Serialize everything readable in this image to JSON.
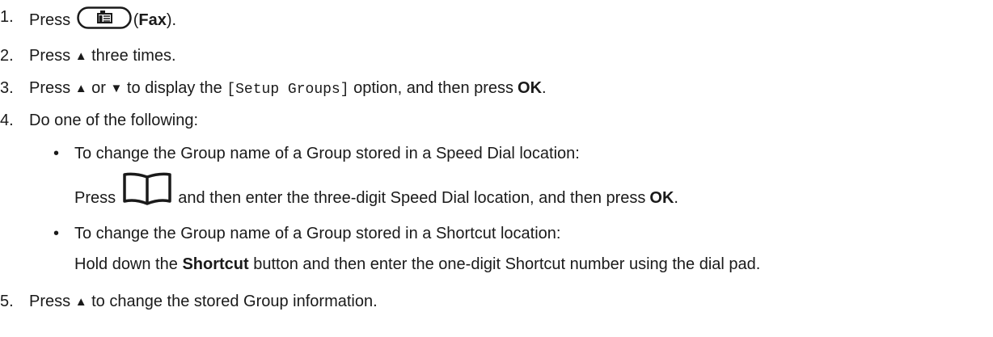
{
  "steps": {
    "s1": {
      "num": "1.",
      "t1": "Press",
      "t2": "(",
      "bold": "Fax",
      "t3": ")."
    },
    "s2": {
      "num": "2.",
      "t1": "Press",
      "up": "▲",
      "t2": "three times."
    },
    "s3": {
      "num": "3.",
      "t1": "Press",
      "up": "▲",
      "t2": "or",
      "down": "▼",
      "t3": "to display the",
      "code": "[Setup Groups]",
      "t4": "option, and then press",
      "bold": "OK",
      "t5": "."
    },
    "s4": {
      "num": "4.",
      "text": "Do one of the following:",
      "b1": {
        "bullet": "•",
        "text": "To change the Group name of a Group stored in a Speed Dial location:",
        "t1": "Press",
        "t2": "and then enter the three-digit Speed Dial location, and then press",
        "bold": "OK",
        "t3": "."
      },
      "b2": {
        "bullet": "•",
        "text": "To change the Group name of a Group stored in a Shortcut location:",
        "t1": "Hold down the",
        "bold": "Shortcut",
        "t2": "button and then enter the one-digit Shortcut number using the dial pad."
      }
    },
    "s5": {
      "num": "5.",
      "t1": "Press",
      "up": "▲",
      "t2": "to change the stored Group information."
    }
  },
  "icons": {
    "fax": "fax-icon",
    "book": "address-book-icon"
  }
}
